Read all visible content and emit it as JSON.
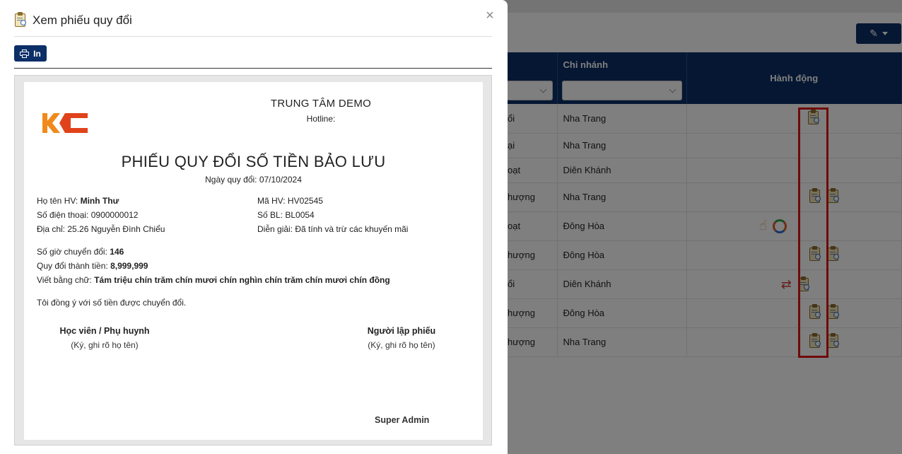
{
  "modal": {
    "title": "Xem phiếu quy đổi",
    "print_label": "In",
    "close_symbol": "×"
  },
  "receipt": {
    "center_name": "TRUNG TÂM DEMO",
    "hotline_label": "Hotline:",
    "title": "PHIẾU QUY ĐỔI SỐ TIỀN BẢO LƯU",
    "date_line": "Ngày quy đổi: 07/10/2024",
    "student_name_label": "Họ tên HV:",
    "student_name": "Minh Thư",
    "phone_line": "Số điện thoại: 0900000012",
    "address_line": "Địa chỉ: 25.26 Nguyễn Đình Chiểu",
    "student_code_line": "Mã HV: HV02545",
    "bl_code_line": "Số BL: BL0054",
    "note_line": "Diễn giải: Đã tính và trừ các khuyến mãi",
    "hours_label": "Số giờ chuyển đổi:",
    "hours_value": "146",
    "amount_label": "Quy đổi thành tiền:",
    "amount_value": "8,999,999",
    "words_label": "Viết bằng chữ:",
    "words_value": "Tám triệu chín trăm chín mươi chín nghìn chín trăm chín mươi chín đồng",
    "agreement": "Tôi đồng ý với số tiền được chuyển đổi.",
    "sig_left_title": "Học viên / Phụ huynh",
    "sig_left_sub": "(Ký, ghi rõ họ tên)",
    "sig_right_title": "Người lập phiếu",
    "sig_right_sub": "(Ký, ghi rõ họ tên)",
    "signer_name": "Super Admin",
    "logo_text": "KC",
    "logo_colors": [
      "#f08a1c",
      "#e0431b"
    ]
  },
  "background": {
    "headers": {
      "branch": "Chi nhánh",
      "action": "Hành động"
    },
    "rows": [
      {
        "status_fragment": "ổi",
        "branch": "Nha Trang",
        "icons": [
          "clipboard-search"
        ]
      },
      {
        "status_fragment": "ại",
        "branch": "Nha Trang",
        "icons": []
      },
      {
        "status_fragment": "oạt",
        "branch": "Diên Khánh",
        "icons": []
      },
      {
        "status_fragment": "hượng",
        "branch": "Nha Trang",
        "icons": [
          "clipboard-search",
          "clipboard-search"
        ]
      },
      {
        "status_fragment": "oạt",
        "branch": "Đông Hòa",
        "icons": [
          "hand",
          "cycle"
        ]
      },
      {
        "status_fragment": "hượng",
        "branch": "Đông Hòa",
        "icons": [
          "clipboard-search",
          "clipboard-search"
        ]
      },
      {
        "status_fragment": "ổi",
        "branch": "Diên Khánh",
        "icons": [
          "swap",
          "clipboard-search"
        ]
      },
      {
        "status_fragment": "hượng",
        "branch": "Đông Hòa",
        "icons": [
          "clipboard-search",
          "clipboard-search"
        ]
      },
      {
        "status_fragment": "hượng",
        "branch": "Nha Trang",
        "icons": [
          "clipboard-search",
          "clipboard-search"
        ]
      }
    ],
    "colors": {
      "header_bg": "#0b2f66",
      "highlight": "#e01515"
    }
  }
}
